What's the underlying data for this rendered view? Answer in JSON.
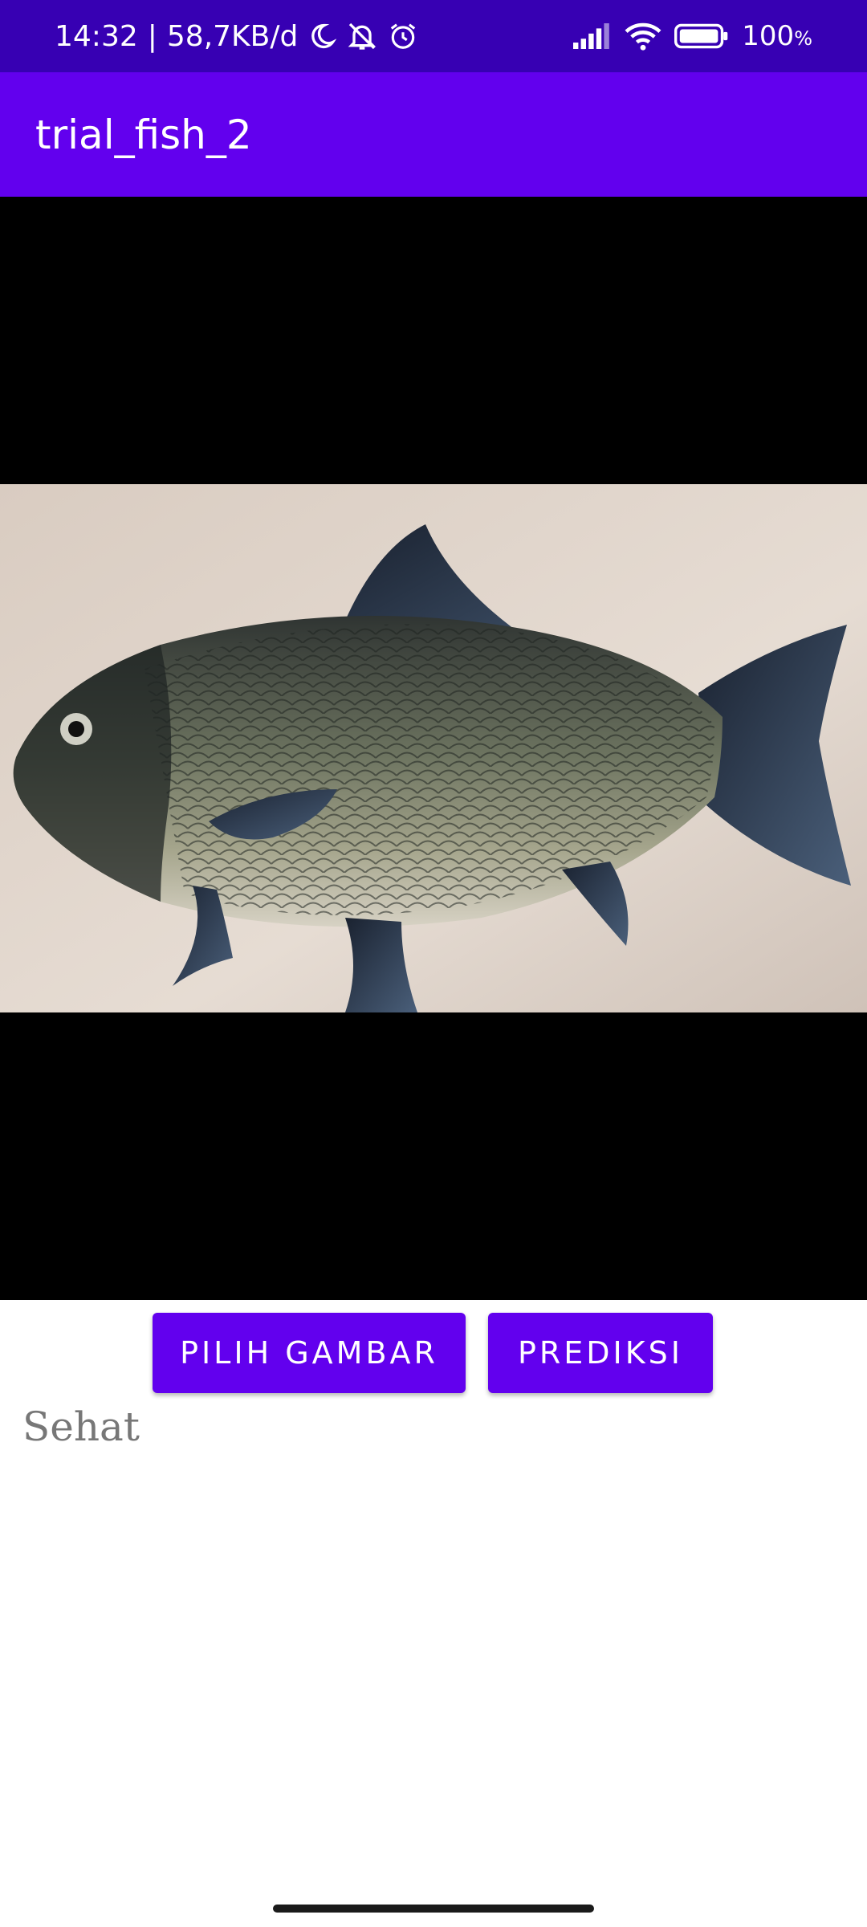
{
  "status_bar": {
    "time": "14:32",
    "separator": "|",
    "network_speed": "58,7KB/d",
    "battery_percent": "100",
    "battery_sign": "%",
    "icons": [
      "moon-icon",
      "mute-icon",
      "alarm-icon",
      "signal-icon",
      "wifi-icon",
      "battery-icon"
    ]
  },
  "app_bar": {
    "title": "trial_fish_2"
  },
  "image_view": {
    "content": "fish photo"
  },
  "buttons": {
    "pilih_gambar": "PILIH GAMBAR",
    "prediksi": "PREDIKSI"
  },
  "result": {
    "text": "Sehat"
  },
  "colors": {
    "status_bar": "#3700b3",
    "app_bar": "#6200ee",
    "button": "#6200ee",
    "image_background": "#000000",
    "result_text": "#777777"
  }
}
